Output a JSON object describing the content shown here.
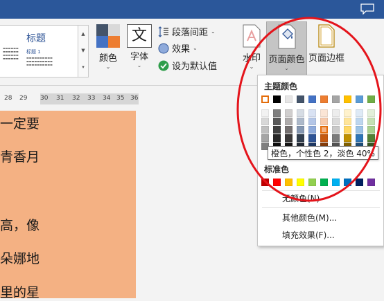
{
  "ribbon": {
    "styles_gallery": {
      "title": "标题",
      "subtitle": "标题 1"
    },
    "colors_label": "颜色",
    "fonts_label": "字体",
    "fonts_glyph": "文",
    "paragraph_spacing_label": "段落间距",
    "effects_label": "效果",
    "set_default_label": "设为默认值",
    "watermark_label": "水印",
    "page_color_label": "页面颜色",
    "page_borders_label": "页面边框"
  },
  "ruler": {
    "numbers": [
      "28",
      "29",
      "30",
      "31",
      "32",
      "33",
      "34",
      "35",
      "36"
    ]
  },
  "document": {
    "lines": [
      "一定要",
      "青香月",
      "",
      "高，像",
      "朵娜地",
      "里的星"
    ]
  },
  "page_color_menu": {
    "theme_colors_heading": "主题颜色",
    "standard_colors_heading": "标准色",
    "no_color_label": "无颜色(N)",
    "more_colors_label": "其他颜色(M)...",
    "fill_effects_label": "填充效果(F)...",
    "theme_top_row": [
      "#ffffff",
      "#000000",
      "#e7e6e6",
      "#44546a",
      "#4472c4",
      "#ed7d31",
      "#a5a5a5",
      "#ffc000",
      "#5b9bd5",
      "#70ad47"
    ],
    "theme_shades": [
      [
        "#f2f2f2",
        "#7f7f7f",
        "#d0cece",
        "#d6dce4",
        "#d9e2f3",
        "#fbe5d5",
        "#ededed",
        "#fff2cc",
        "#deeaf6",
        "#e2efd9"
      ],
      [
        "#d8d8d8",
        "#595959",
        "#aeabab",
        "#adb9ca",
        "#b4c6e7",
        "#f7caac",
        "#dbdbdb",
        "#ffe599",
        "#bdd6ee",
        "#c5e0b3"
      ],
      [
        "#bfbfbf",
        "#3f3f3f",
        "#757070",
        "#8496b0",
        "#8eaadb",
        "#f4b183",
        "#c9c9c9",
        "#ffd966",
        "#9cc3e5",
        "#a8d08d"
      ],
      [
        "#a5a5a5",
        "#262626",
        "#3a3838",
        "#323f4f",
        "#2f5496",
        "#c55a11",
        "#7b7b7b",
        "#bf9000",
        "#2e75b5",
        "#538135"
      ],
      [
        "#7f7f7f",
        "#0d0d0d",
        "#171616",
        "#222a35",
        "#1f3864",
        "#833c0b",
        "#525252",
        "#7f6000",
        "#1e4e79",
        "#375623"
      ]
    ],
    "standard_colors": [
      "#c00000",
      "#ff0000",
      "#ffc000",
      "#ffff00",
      "#92d050",
      "#00b050",
      "#00b0f0",
      "#0070c0",
      "#002060",
      "#7030a0"
    ],
    "hover_tooltip": "橙色，个性色 2，淡色 40%"
  },
  "colors": {
    "titlebar": "#2b579a",
    "document_background": "#f4b183",
    "highlight_circle": "#e4141b"
  }
}
